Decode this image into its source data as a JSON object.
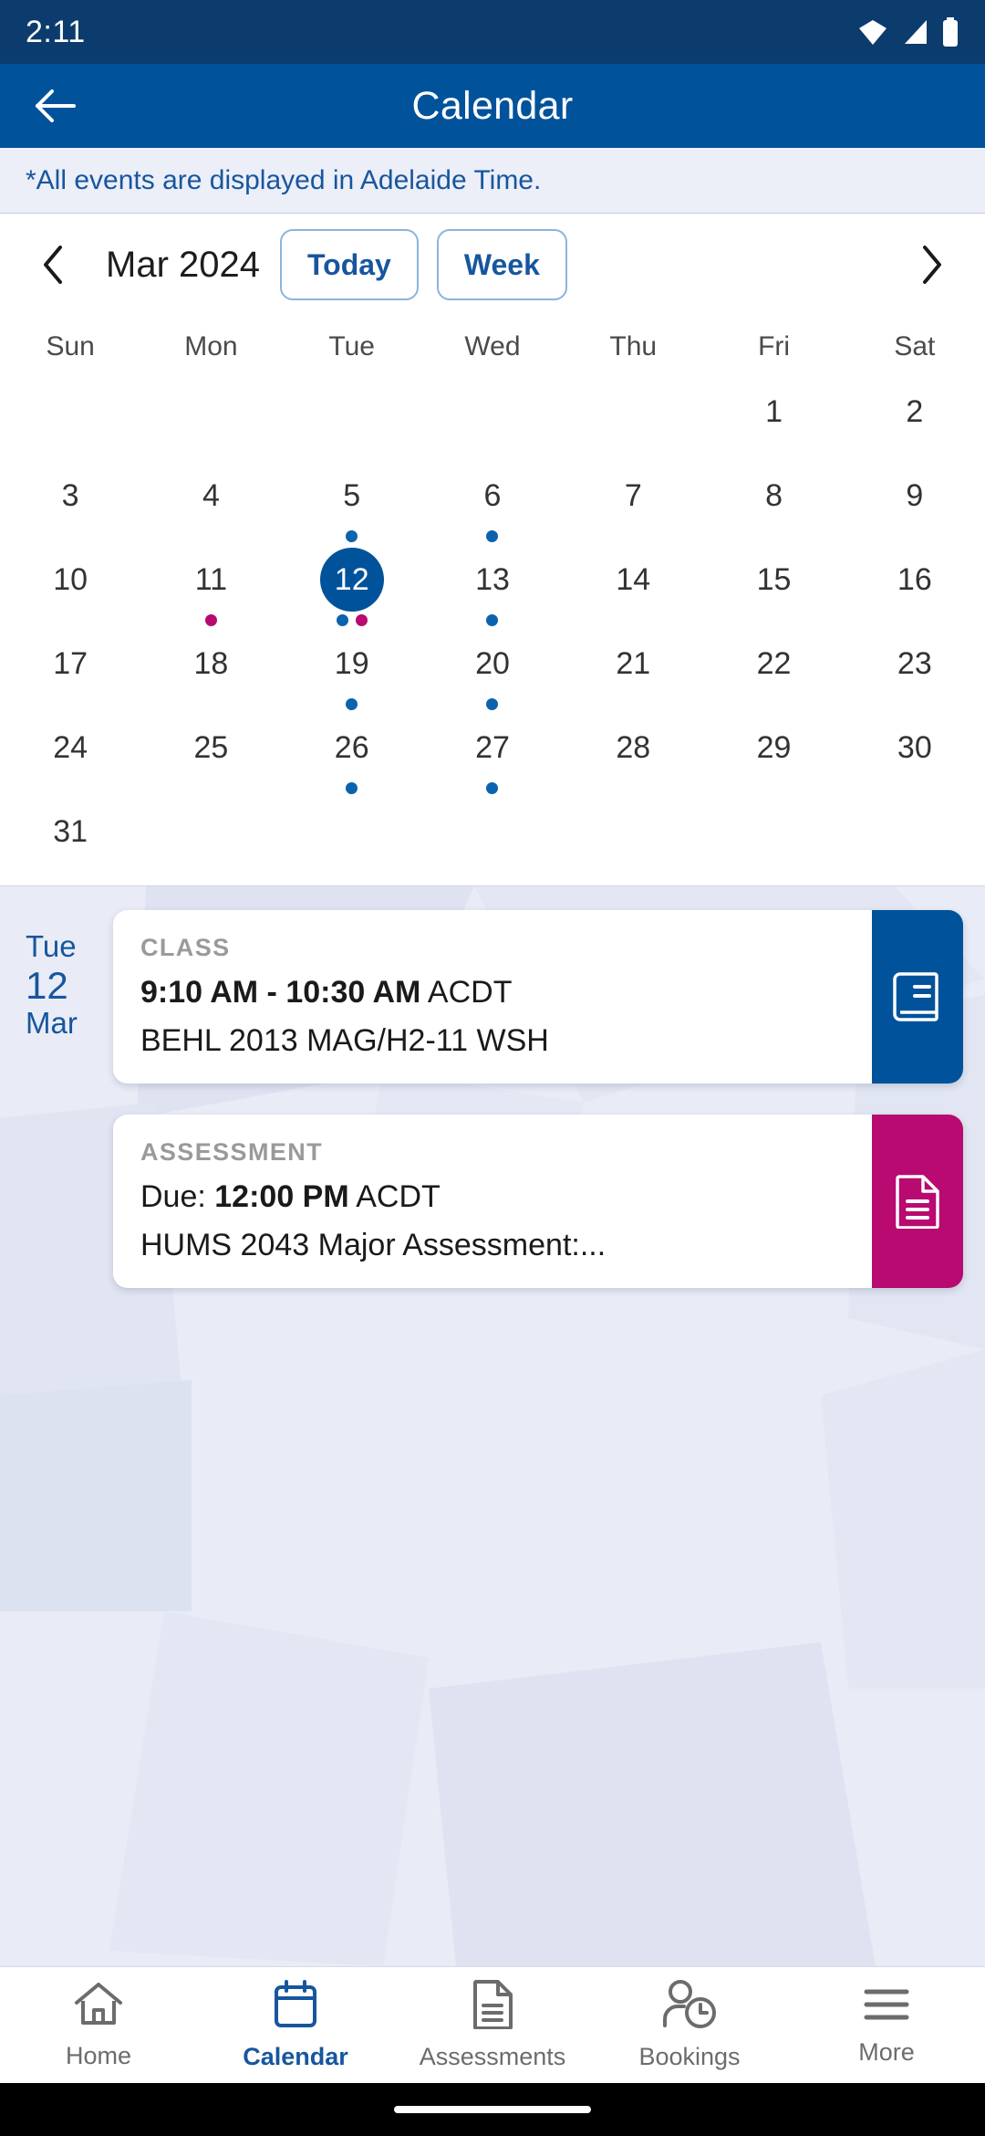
{
  "status_bar": {
    "time": "2:11",
    "icons": [
      "wifi-icon",
      "signal-icon",
      "battery-icon"
    ]
  },
  "app_bar": {
    "back_icon": "arrow-left-icon",
    "title": "Calendar"
  },
  "notice": {
    "text": "*All events are displayed in Adelaide Time."
  },
  "calendar": {
    "prev_icon": "chevron-left-icon",
    "next_icon": "chevron-right-icon",
    "month_label": "Mar 2024",
    "today_label": "Today",
    "week_label": "Week",
    "weekdays": [
      "Sun",
      "Mon",
      "Tue",
      "Wed",
      "Thu",
      "Fri",
      "Sat"
    ],
    "selected_day": 12,
    "weeks": [
      [
        {
          "day": "",
          "dots": []
        },
        {
          "day": "",
          "dots": []
        },
        {
          "day": "",
          "dots": []
        },
        {
          "day": "",
          "dots": []
        },
        {
          "day": "",
          "dots": []
        },
        {
          "day": "1",
          "dots": []
        },
        {
          "day": "2",
          "dots": []
        }
      ],
      [
        {
          "day": "3",
          "dots": []
        },
        {
          "day": "4",
          "dots": []
        },
        {
          "day": "5",
          "dots": [
            "blue"
          ]
        },
        {
          "day": "6",
          "dots": [
            "blue"
          ]
        },
        {
          "day": "7",
          "dots": []
        },
        {
          "day": "8",
          "dots": []
        },
        {
          "day": "9",
          "dots": []
        }
      ],
      [
        {
          "day": "10",
          "dots": []
        },
        {
          "day": "11",
          "dots": [
            "pink"
          ]
        },
        {
          "day": "12",
          "dots": [
            "blue",
            "pink"
          ],
          "selected": true
        },
        {
          "day": "13",
          "dots": [
            "blue"
          ]
        },
        {
          "day": "14",
          "dots": []
        },
        {
          "day": "15",
          "dots": []
        },
        {
          "day": "16",
          "dots": []
        }
      ],
      [
        {
          "day": "17",
          "dots": []
        },
        {
          "day": "18",
          "dots": []
        },
        {
          "day": "19",
          "dots": [
            "blue"
          ]
        },
        {
          "day": "20",
          "dots": [
            "blue"
          ]
        },
        {
          "day": "21",
          "dots": []
        },
        {
          "day": "22",
          "dots": []
        },
        {
          "day": "23",
          "dots": []
        }
      ],
      [
        {
          "day": "24",
          "dots": []
        },
        {
          "day": "25",
          "dots": []
        },
        {
          "day": "26",
          "dots": [
            "blue"
          ]
        },
        {
          "day": "27",
          "dots": [
            "blue"
          ]
        },
        {
          "day": "28",
          "dots": []
        },
        {
          "day": "29",
          "dots": []
        },
        {
          "day": "30",
          "dots": []
        }
      ],
      [
        {
          "day": "31",
          "dots": []
        },
        {
          "day": "",
          "dots": []
        },
        {
          "day": "",
          "dots": []
        },
        {
          "day": "",
          "dots": []
        },
        {
          "day": "",
          "dots": []
        },
        {
          "day": "",
          "dots": []
        },
        {
          "day": "",
          "dots": []
        }
      ]
    ]
  },
  "agenda": {
    "date": {
      "weekday": "Tue",
      "day": "12",
      "month": "Mar"
    },
    "events": [
      {
        "kind": "CLASS",
        "time_bold": "9:10 AM - 10:30 AM",
        "time_suffix": " ACDT",
        "time_prefix": "",
        "subtitle": "BEHL 2013 MAG/H2-11 WSH",
        "accent": "#00529b",
        "icon": "book-icon"
      },
      {
        "kind": "ASSESSMENT",
        "time_prefix": "Due: ",
        "time_bold": "12:00 PM",
        "time_suffix": " ACDT",
        "subtitle": "HUMS 2043 Major Assessment:...",
        "accent": "#b80a70",
        "icon": "document-icon"
      }
    ]
  },
  "bottom_nav": {
    "items": [
      {
        "label": "Home",
        "icon": "home-icon",
        "active": false
      },
      {
        "label": "Calendar",
        "icon": "calendar-icon",
        "active": true
      },
      {
        "label": "Assessments",
        "icon": "document-icon",
        "active": false
      },
      {
        "label": "Bookings",
        "icon": "person-clock-icon",
        "active": false
      },
      {
        "label": "More",
        "icon": "hamburger-icon",
        "active": false
      }
    ]
  },
  "colors": {
    "status_bar": "#0c3c6e",
    "app_bar": "#00529b",
    "accent_blue": "#17569e",
    "accent_pink": "#b80a70",
    "notice_bg": "#eceef8"
  }
}
